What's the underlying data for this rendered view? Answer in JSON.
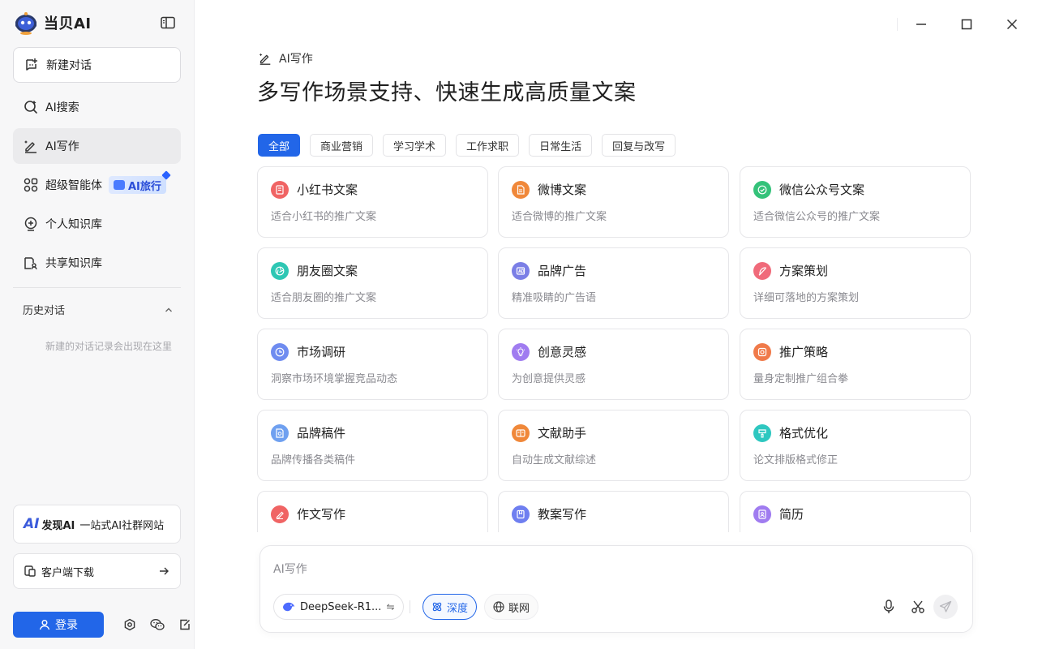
{
  "app": {
    "name": "当贝AI"
  },
  "sidebar": {
    "new_chat_label": "新建对话",
    "items": [
      {
        "label": "AI搜索"
      },
      {
        "label": "AI写作"
      },
      {
        "label": "超级智能体",
        "badge": "AI旅行"
      },
      {
        "label": "个人知识库"
      },
      {
        "label": "共享知识库"
      }
    ],
    "history_title": "历史对话",
    "history_empty": "新建的对话记录会出现在这里",
    "promo": {
      "logo": "AI",
      "name": "发现AI",
      "tagline": "一站式AI社群网站"
    },
    "download_label": "客户端下载",
    "login_label": "登录"
  },
  "main": {
    "breadcrumb": "AI写作",
    "title": "多写作场景支持、快速生成高质量文案",
    "tabs": [
      "全部",
      "商业营销",
      "学习学术",
      "工作求职",
      "日常生活",
      "回复与改写"
    ],
    "active_tab": 0,
    "cards": [
      {
        "title": "小红书文案",
        "desc": "适合小红书的推广文案",
        "icon": "note-icon",
        "color": "#f06464"
      },
      {
        "title": "微博文案",
        "desc": "适合微博的推广文案",
        "icon": "document-icon",
        "color": "#f0883a"
      },
      {
        "title": "微信公众号文案",
        "desc": "适合微信公众号的推广文案",
        "icon": "check-badge-icon",
        "color": "#34c27a"
      },
      {
        "title": "朋友圈文案",
        "desc": "适合朋友圈的推广文案",
        "icon": "aperture-icon",
        "color": "#2ec7b4"
      },
      {
        "title": "品牌广告",
        "desc": "精准吸睛的广告语",
        "icon": "ad-icon",
        "color": "#7b7fe6"
      },
      {
        "title": "方案策划",
        "desc": "详细可落地的方案策划",
        "icon": "feather-icon",
        "color": "#f06a7a"
      },
      {
        "title": "市场调研",
        "desc": "洞察市场环境掌握竞品动态",
        "icon": "clock-icon",
        "color": "#6f8cf0"
      },
      {
        "title": "创意灵感",
        "desc": "为创意提供灵感",
        "icon": "bulb-icon",
        "color": "#a07cf0"
      },
      {
        "title": "推广策略",
        "desc": "量身定制推广组合拳",
        "icon": "target-icon",
        "color": "#f07a4a"
      },
      {
        "title": "品牌稿件",
        "desc": "品牌传播各类稿件",
        "icon": "file-seal-icon",
        "color": "#6fa0f0"
      },
      {
        "title": "文献助手",
        "desc": "自动生成文献综述",
        "icon": "book-icon",
        "color": "#f0883a"
      },
      {
        "title": "格式优化",
        "desc": "论文排版格式修正",
        "icon": "brush-icon",
        "color": "#2ec7c0"
      },
      {
        "title": "作文写作",
        "desc": "",
        "icon": "pencil-icon",
        "color": "#f06464"
      },
      {
        "title": "教案写作",
        "desc": "",
        "icon": "bookmark-icon",
        "color": "#6f7ff0"
      },
      {
        "title": "简历",
        "desc": "",
        "icon": "id-card-icon",
        "color": "#a07cf0"
      }
    ]
  },
  "composer": {
    "placeholder": "AI写作",
    "model_label": "DeepSeek-R1...",
    "swap_glyph": "⇋",
    "deep_label": "深度",
    "web_label": "联网"
  },
  "colors": {
    "accent": "#2266e8",
    "sidebar_bg": "#f7f7f8",
    "border": "#e6e6e9"
  }
}
